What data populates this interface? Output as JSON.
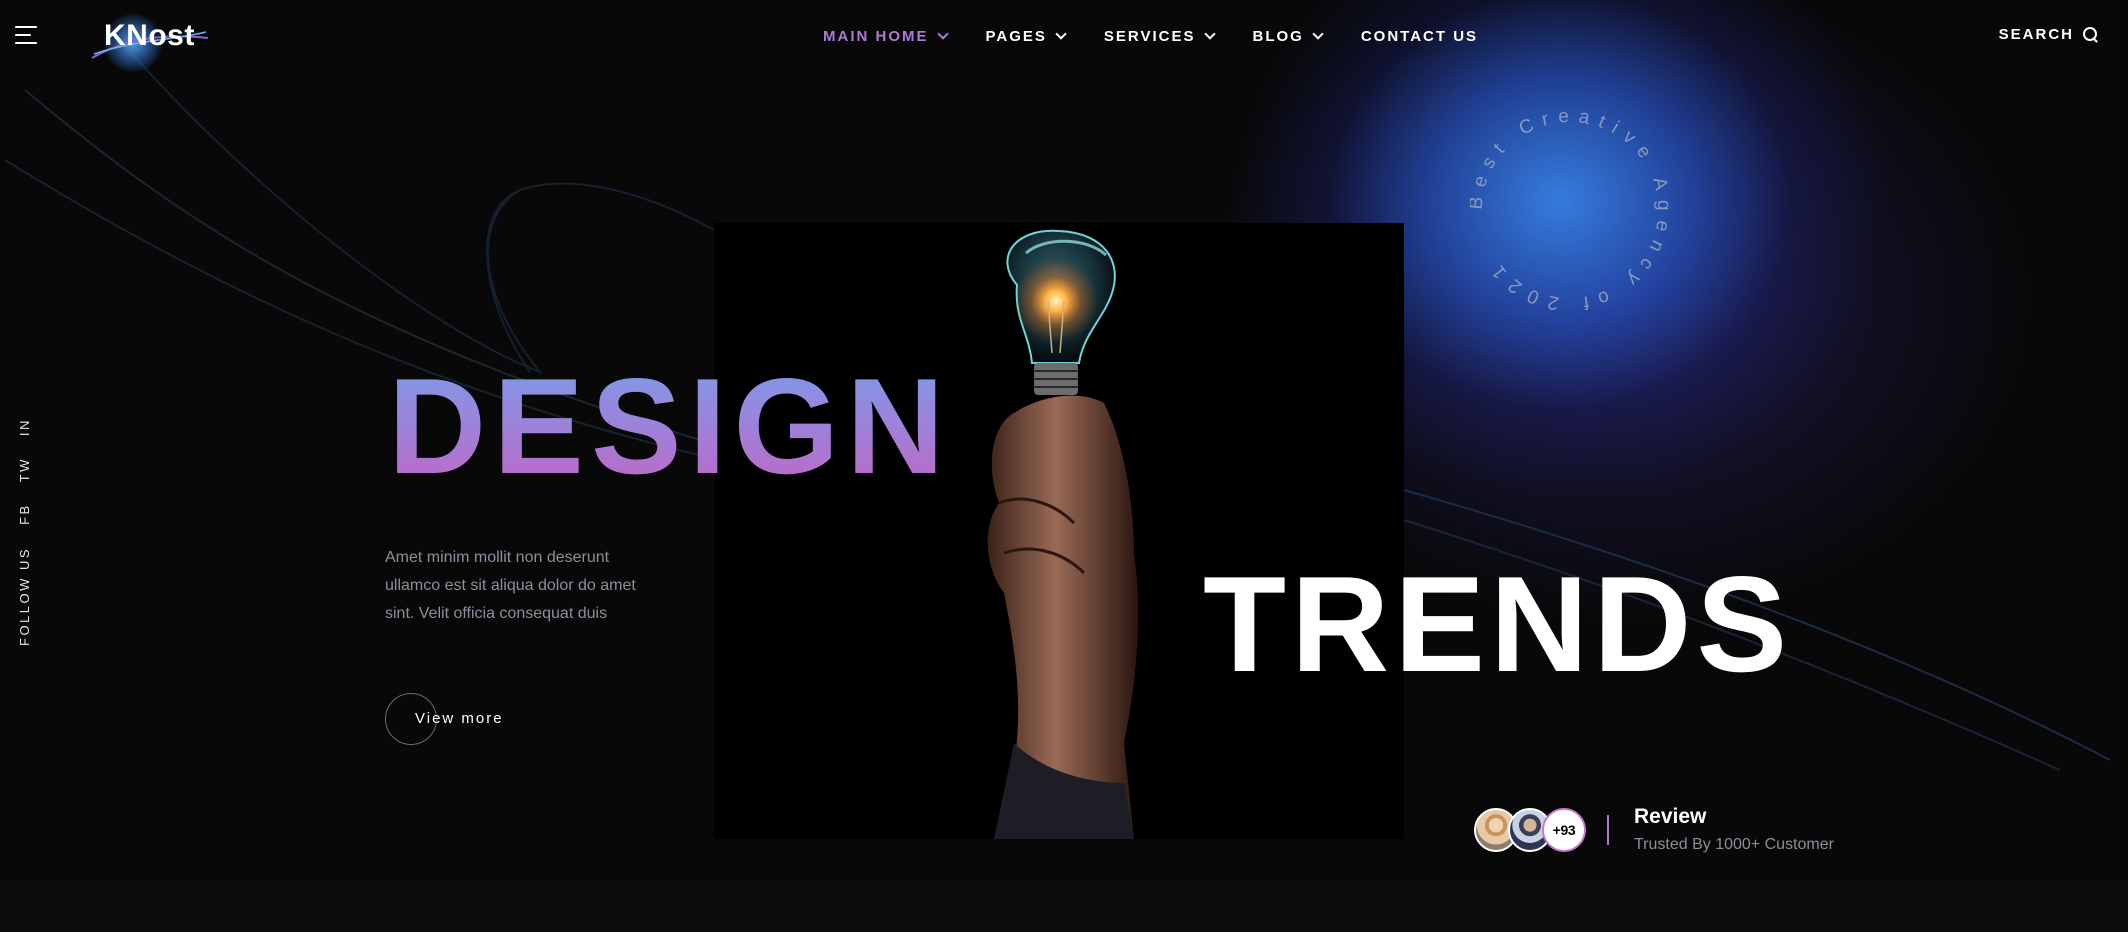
{
  "brand": {
    "logo_text": "KNost"
  },
  "nav": {
    "items": [
      {
        "label": "MAIN HOME",
        "active": true,
        "has_dropdown": true
      },
      {
        "label": "PAGES",
        "active": false,
        "has_dropdown": true
      },
      {
        "label": "SERVICES",
        "active": false,
        "has_dropdown": true
      },
      {
        "label": "BLOG",
        "active": false,
        "has_dropdown": true
      },
      {
        "label": "CONTACT US",
        "active": false,
        "has_dropdown": false
      }
    ],
    "search_label": "SEARCH"
  },
  "social": {
    "follow_label": "FOLLOW US",
    "links": [
      "FB",
      "TW",
      "IN"
    ]
  },
  "hero": {
    "headline_1": "DESIGN",
    "headline_2": "TRENDS",
    "description": "Amet minim mollit non deserunt ullamco est sit aliqua dolor do amet sint. Velit officia consequat duis",
    "cta_label": "View more",
    "badge_text": "Best Creative Agency of 2021"
  },
  "review": {
    "extra_count": "+93",
    "title": "Review",
    "subtitle": "Trusted By 1000+ Customer"
  },
  "colors": {
    "accent": "#b07ad2",
    "background": "#080808",
    "glow": "#3a86e0"
  },
  "icons": [
    "hamburger-menu-icon",
    "chevron-down-icon",
    "search-icon"
  ]
}
